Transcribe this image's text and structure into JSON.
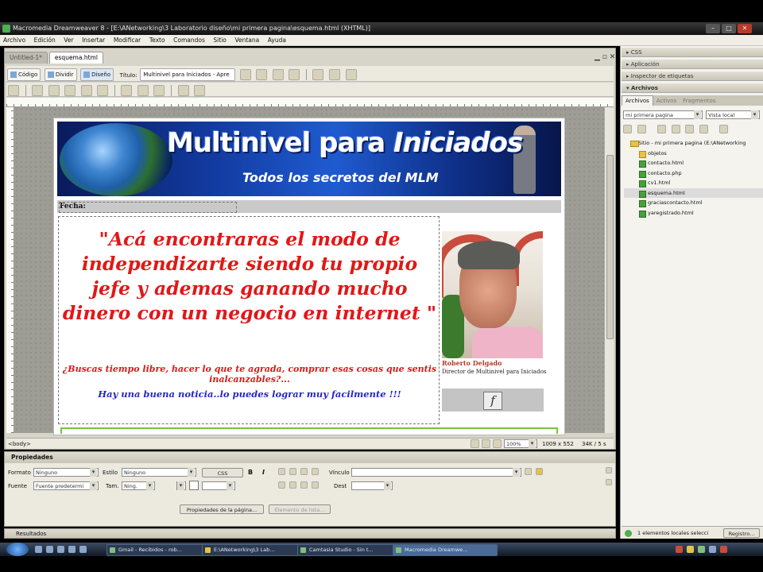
{
  "window": {
    "title": "Macromedia Dreamweaver 8 - [E:\\ANetworking\\3 Laboratorio diseño\\mi primera pagina\\esquema.html (XHTML)]"
  },
  "menu": [
    "Archivo",
    "Edición",
    "Ver",
    "Insertar",
    "Modificar",
    "Texto",
    "Comandos",
    "Sitio",
    "Ventana",
    "Ayuda"
  ],
  "document_tabs": [
    "Untitled-1*",
    "esquema.html"
  ],
  "doc_toolbar": {
    "code": "Código",
    "split": "Dividir",
    "design": "Diseño",
    "title_label": "Título:",
    "title_value": "Multinivel para Iniciados - Apre"
  },
  "page": {
    "banner_title_a": "Multinivel para ",
    "banner_title_b": "Iniciados",
    "banner_subtitle": "Todos los secretos del MLM",
    "fecha_label": "Fecha:",
    "quote": "\"Acá encontraras el modo de independizarte siendo tu propio jefe y ademas ganando mucho dinero con un negocio en internet \"",
    "subtitle1": "¿Buscas tiempo libre, hacer lo que te agrada, comprar esas cosas que sentis inalcanzables?...",
    "subtitle2": "Hay una buena noticia..lo puedes lograr muy facilmente !!!",
    "photo_name": "Roberto Delgado",
    "photo_caption": "Director de Multinivel para Iniciados",
    "flash_glyph": "f"
  },
  "status": {
    "tag": "<body>",
    "zoom": "100%",
    "size": "1009 x 552",
    "download": "34K / 5 s"
  },
  "properties": {
    "header": "Propiedades",
    "formato_label": "Formato",
    "formato_value": "Ninguno",
    "estilo_label": "Estilo",
    "estilo_value": "Ninguno",
    "css_button": "CSS",
    "bold": "B",
    "italic": "I",
    "vinculo_label": "Vínculo",
    "fuente_label": "Fuente",
    "fuente_value": "Fuente predetermi",
    "tam_label": "Tam.",
    "tam_value": "Ning.",
    "dest_label": "Dest",
    "page_props_button": "Propiedades de la página...",
    "list_item_button": "Elemento de lista..."
  },
  "results_bar": "Resultados",
  "right_panels": {
    "css": "CSS",
    "aplicacion": "Aplicación",
    "inspector": "Inspector de etiquetas",
    "archivos": "Archivos",
    "file_tabs": [
      "Archivos",
      "Activos",
      "Fragmentos"
    ],
    "site_select": "mi primera pagina",
    "view_select": "Vista local",
    "tree_root": "Sitio - mi primera pagina (E:\\ANetworking",
    "tree_items": [
      "objetos",
      "contacto.html",
      "contacto.php",
      "cv1.html",
      "esquema.html",
      "graciascontacto.html",
      "yaregistrado.html"
    ],
    "status_text": "1 elementos locales selecci",
    "registro_button": "Registro..."
  },
  "taskbar": {
    "items": [
      "Gmail - Recibidos - rob...",
      "E:\\ANetworking\\3 Lab...",
      "Camtasia Studio - Sin t...",
      "Macromedia Dreamwe..."
    ]
  },
  "colors": {
    "quote_red": "#e01818",
    "notice_blue": "#2727c8",
    "banner_blue": "#1f5bd0",
    "name_brown": "#b23a2a"
  }
}
